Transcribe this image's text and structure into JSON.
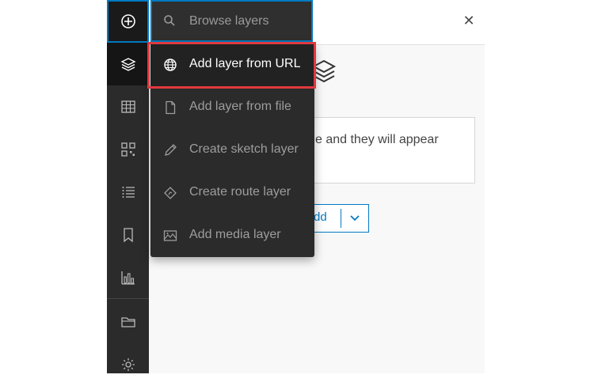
{
  "search": {
    "placeholder": "Browse layers"
  },
  "menu": {
    "items": [
      {
        "label": "Add layer from URL",
        "icon": "globe-icon"
      },
      {
        "label": "Add layer from file",
        "icon": "file-icon"
      },
      {
        "label": "Create sketch layer",
        "icon": "pencil-icon"
      },
      {
        "label": "Create route layer",
        "icon": "route-icon"
      },
      {
        "label": "Add media layer",
        "icon": "image-icon"
      }
    ]
  },
  "panel": {
    "info_text": "e and they will appear",
    "split_button_label": "dd"
  },
  "toolbar": {
    "items": [
      "add-icon",
      "layers-icon",
      "table-icon",
      "qr-icon",
      "list-icon",
      "bookmark-icon",
      "chart-icon",
      "folder-icon",
      "settings-icon"
    ]
  },
  "colors": {
    "accent": "#007ac2",
    "highlight": "#e0393e",
    "toolbar_bg": "#2b2b2b"
  }
}
